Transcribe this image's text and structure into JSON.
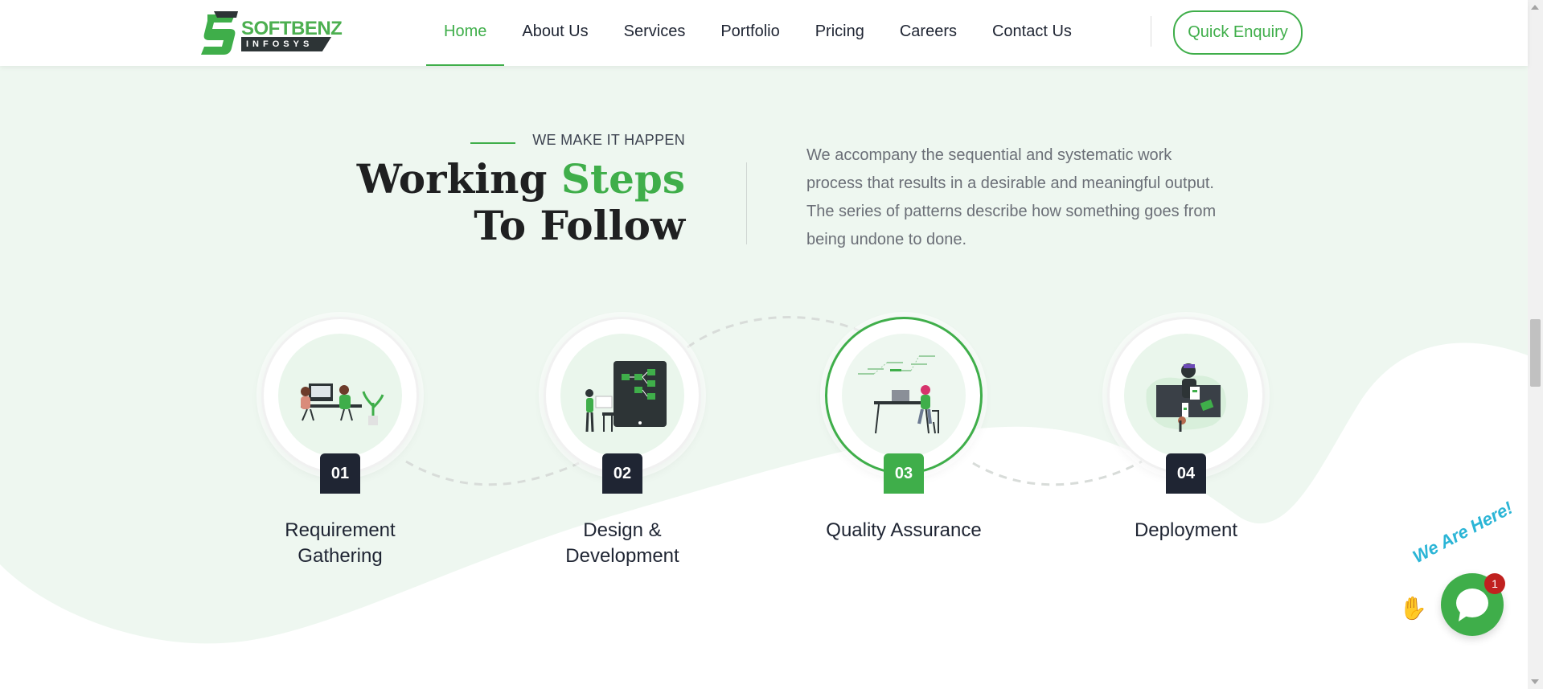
{
  "header": {
    "logo": {
      "name": "SOFTBENZ",
      "sub": "INFOSYS"
    },
    "nav": [
      {
        "label": "Home",
        "active": true
      },
      {
        "label": "About Us"
      },
      {
        "label": "Services"
      },
      {
        "label": "Portfolio"
      },
      {
        "label": "Pricing"
      },
      {
        "label": "Careers"
      },
      {
        "label": "Contact Us"
      }
    ],
    "cta": "Quick Enquiry"
  },
  "section": {
    "eyebrow": "WE MAKE IT HAPPEN",
    "heading_part1": "Working ",
    "heading_accent": "Steps",
    "heading_part2": "To Follow",
    "description": "We accompany the sequential and systematic work process that results in a desirable and meaningful output. The series of patterns describe how something goes from being undone to done."
  },
  "steps": [
    {
      "number": "01",
      "title": "Requirement Gathering",
      "icon": "office-team-illustration"
    },
    {
      "number": "02",
      "title": "Design & Development",
      "icon": "design-board-illustration"
    },
    {
      "number": "03",
      "title": "Quality Assurance",
      "icon": "testing-desk-illustration",
      "active": true
    },
    {
      "number": "04",
      "title": "Deployment",
      "icon": "deployment-illustration"
    }
  ],
  "chat": {
    "label": "We Are Here!",
    "badge": "1",
    "icon": "chat-bubble-icon"
  },
  "colors": {
    "accent": "#3fae4a",
    "dark": "#1f2533",
    "section_bg": "#eef7f0"
  }
}
